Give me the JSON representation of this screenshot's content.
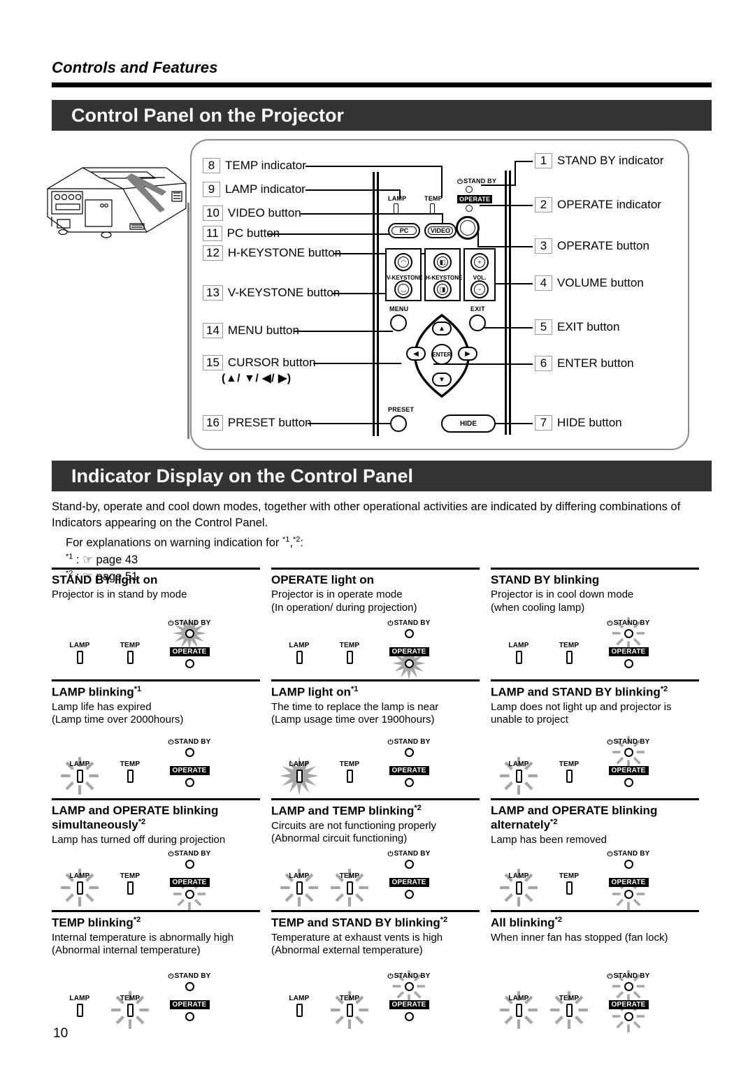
{
  "running_head": "Controls and Features",
  "page_number": "10",
  "sections": {
    "control_panel": {
      "title": "Control Panel on the Projector"
    },
    "indicator_display": {
      "title": "Indicator Display on the Control Panel"
    }
  },
  "diagram": {
    "callouts_right": [
      {
        "num": "1",
        "label": "STAND BY indicator"
      },
      {
        "num": "2",
        "label": "OPERATE indicator"
      },
      {
        "num": "3",
        "label": "OPERATE button"
      },
      {
        "num": "4",
        "label": "VOLUME button"
      },
      {
        "num": "5",
        "label": "EXIT button"
      },
      {
        "num": "6",
        "label": "ENTER button"
      },
      {
        "num": "7",
        "label": "HIDE button"
      }
    ],
    "callouts_left": [
      {
        "num": "8",
        "label": "TEMP indicator",
        "sub": ""
      },
      {
        "num": "9",
        "label": "LAMP indicator",
        "sub": ""
      },
      {
        "num": "10",
        "label": "VIDEO button",
        "sub": ""
      },
      {
        "num": "11",
        "label": "PC button",
        "sub": ""
      },
      {
        "num": "12",
        "label": "H-KEYSTONE button",
        "sub": ""
      },
      {
        "num": "13",
        "label": "V-KEYSTONE button",
        "sub": ""
      },
      {
        "num": "14",
        "label": "MENU button",
        "sub": ""
      },
      {
        "num": "15",
        "label": "CURSOR button",
        "sub": "(▲/ ▼/ ◀/ ▶)"
      },
      {
        "num": "16",
        "label": "PRESET button",
        "sub": ""
      }
    ],
    "panel_art": {
      "lamp_label": "LAMP",
      "temp_label": "TEMP",
      "standby_label": "STAND BY",
      "operate_label": "OPERATE",
      "pc_label": "PC",
      "video_label": "VIDEO",
      "vkeystone_label": "V-KEYSTONE",
      "hkeystone_label": "H-KEYSTONE",
      "vol_label": "VOL.",
      "vol_plus": "＋",
      "vol_minus": "－",
      "menu_label": "MENU",
      "exit_label": "EXIT",
      "enter_label": "ENTER",
      "preset_label": "PRESET",
      "hide_label": "HIDE",
      "cursor_up": "▲",
      "cursor_down": "▼",
      "cursor_left": "◀",
      "cursor_right": "▶"
    }
  },
  "intro": {
    "paragraph": "Stand-by, operate and cool down modes, together with other operational activities are indicated by differing combinations of Indicators appearing on the Control Panel.",
    "note_lead": "For explanations on warning indication for *1,*2:",
    "note_1": "*1 : ☞ page 43",
    "note_2": "*2 : ☞ page 51"
  },
  "indicator_labels": {
    "lamp": "LAMP",
    "temp": "TEMP",
    "standby": "STAND BY",
    "operate": "OPERATE"
  },
  "indicator_states": [
    {
      "title": "STAND BY light on",
      "lines": [
        "Projector is in stand by mode"
      ],
      "lamp": "off",
      "temp": "off",
      "standby": "on",
      "operate": "off"
    },
    {
      "title": "OPERATE light on",
      "lines": [
        "Projector is in operate mode",
        "(In operation/ during projection)"
      ],
      "lamp": "off",
      "temp": "off",
      "standby": "off",
      "operate": "on"
    },
    {
      "title": "STAND BY blinking",
      "lines": [
        "Projector is in cool down mode",
        "(when cooling lamp)"
      ],
      "lamp": "off",
      "temp": "off",
      "standby": "blink",
      "operate": "off"
    },
    {
      "title": "LAMP blinking*1",
      "lines": [
        "Lamp life has expired",
        "(Lamp time over 2000hours)"
      ],
      "lamp": "blink",
      "temp": "off",
      "standby": "off",
      "operate": "off"
    },
    {
      "title": "LAMP light on*1",
      "lines": [
        "The time to replace the lamp is near",
        "(Lamp usage time over 1900hours)"
      ],
      "lamp": "on",
      "temp": "off",
      "standby": "off",
      "operate": "off"
    },
    {
      "title": "LAMP and STAND BY blinking*2",
      "lines": [
        "Lamp does not light up and projector is unable to project"
      ],
      "lamp": "blink",
      "temp": "off",
      "standby": "blink",
      "operate": "off"
    },
    {
      "title": "LAMP and OPERATE blinking simultaneously*2",
      "lines": [
        "Lamp has turned off during projection"
      ],
      "lamp": "blink",
      "temp": "off",
      "standby": "off",
      "operate": "blink"
    },
    {
      "title": "LAMP and TEMP blinking*2",
      "lines": [
        "Circuits are not functioning properly",
        "(Abnormal circuit functioning)"
      ],
      "lamp": "blink",
      "temp": "blink",
      "standby": "off",
      "operate": "off"
    },
    {
      "title": "LAMP and OPERATE blinking alternately*2",
      "lines": [
        "Lamp has been removed"
      ],
      "lamp": "blink",
      "temp": "off",
      "standby": "off",
      "operate": "blink"
    },
    {
      "title": "TEMP blinking*2",
      "lines": [
        "Internal temperature is abnormally high",
        "(Abnormal internal temperature)"
      ],
      "lamp": "off",
      "temp": "blink",
      "standby": "off",
      "operate": "off"
    },
    {
      "title": "TEMP and STAND BY blinking*2",
      "lines": [
        "Temperature at exhaust vents is high",
        "(Abnormal external temperature)"
      ],
      "lamp": "off",
      "temp": "blink",
      "standby": "blink",
      "operate": "off"
    },
    {
      "title": "All blinking*2",
      "lines": [
        "When inner fan has stopped (fan lock)"
      ],
      "lamp": "blink",
      "temp": "blink",
      "standby": "blink",
      "operate": "blink"
    }
  ],
  "colors": {
    "banner_bg": "#333333",
    "rule": "#000000",
    "ray_gray": "#a6a6a6"
  }
}
